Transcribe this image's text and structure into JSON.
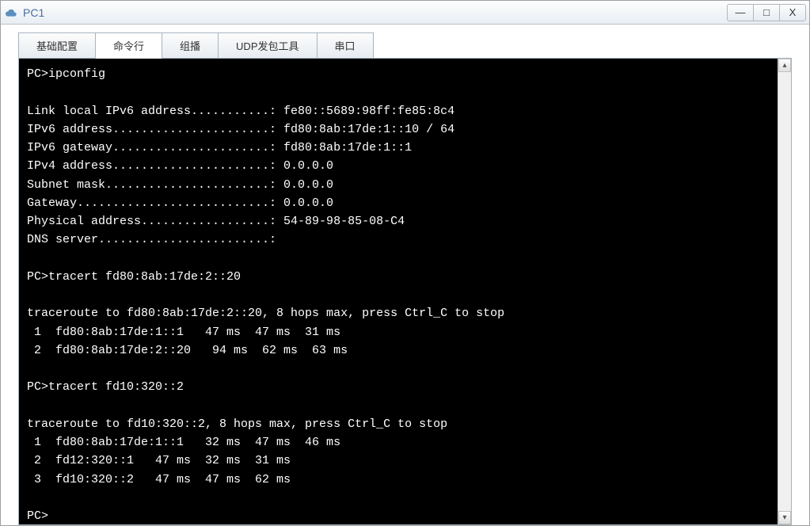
{
  "window": {
    "title": "PC1"
  },
  "controls": {
    "minimize": "—",
    "maximize": "□",
    "close": "X"
  },
  "tabs": {
    "t0": "基础配置",
    "t1": "命令行",
    "t2": "组播",
    "t3": "UDP发包工具",
    "t4": "串口"
  },
  "terminal": {
    "content": "PC>ipconfig\n\nLink local IPv6 address...........: fe80::5689:98ff:fe85:8c4\nIPv6 address......................: fd80:8ab:17de:1::10 / 64\nIPv6 gateway......................: fd80:8ab:17de:1::1\nIPv4 address......................: 0.0.0.0\nSubnet mask.......................: 0.0.0.0\nGateway...........................: 0.0.0.0\nPhysical address..................: 54-89-98-85-08-C4\nDNS server........................:\n\nPC>tracert fd80:8ab:17de:2::20\n\ntraceroute to fd80:8ab:17de:2::20, 8 hops max, press Ctrl_C to stop\n 1  fd80:8ab:17de:1::1   47 ms  47 ms  31 ms\n 2  fd80:8ab:17de:2::20   94 ms  62 ms  63 ms\n\nPC>tracert fd10:320::2\n\ntraceroute to fd10:320::2, 8 hops max, press Ctrl_C to stop\n 1  fd80:8ab:17de:1::1   32 ms  47 ms  46 ms\n 2  fd12:320::1   47 ms  32 ms  31 ms\n 3  fd10:320::2   47 ms  47 ms  62 ms\n\nPC>"
  }
}
